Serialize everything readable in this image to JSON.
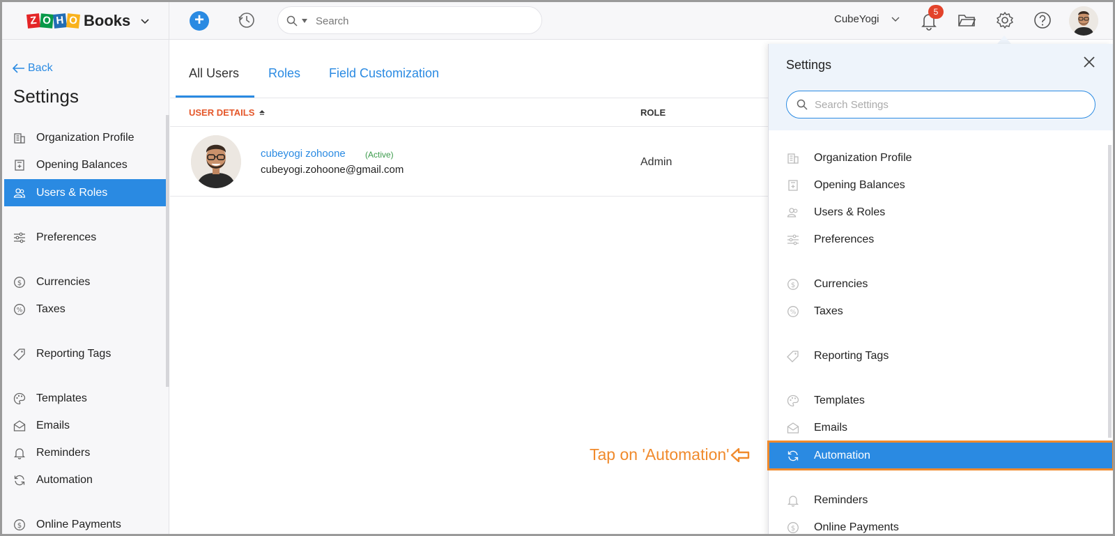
{
  "brand": {
    "letters": [
      "Z",
      "O",
      "H",
      "O"
    ],
    "product": "Books"
  },
  "topbar": {
    "search_placeholder": "Search",
    "org_name": "CubeYogi",
    "notification_count": "5"
  },
  "sidebar": {
    "back_label": "Back",
    "title": "Settings",
    "items": [
      {
        "label": "Organization Profile",
        "icon": "building-icon"
      },
      {
        "label": "Opening Balances",
        "icon": "ledger-icon"
      },
      {
        "label": "Users & Roles",
        "icon": "users-icon"
      },
      {
        "label": "Preferences",
        "icon": "sliders-icon"
      },
      {
        "label": "Currencies",
        "icon": "currency-icon"
      },
      {
        "label": "Taxes",
        "icon": "percent-icon"
      },
      {
        "label": "Reporting Tags",
        "icon": "tag-icon"
      },
      {
        "label": "Templates",
        "icon": "palette-icon"
      },
      {
        "label": "Emails",
        "icon": "envelope-icon"
      },
      {
        "label": "Reminders",
        "icon": "bell-icon"
      },
      {
        "label": "Automation",
        "icon": "refresh-icon"
      },
      {
        "label": "Online Payments",
        "icon": "payment-icon"
      }
    ],
    "active": "Users & Roles"
  },
  "main": {
    "tabs": [
      {
        "label": "All Users"
      },
      {
        "label": "Roles"
      },
      {
        "label": "Field Customization"
      }
    ],
    "table": {
      "col_user": "USER DETAILS",
      "col_role": "ROLE",
      "rows": [
        {
          "name": "cubeyogi zohoone",
          "status": "(Active)",
          "email": "cubeyogi.zohoone@gmail.com",
          "role": "Admin"
        }
      ]
    }
  },
  "panel": {
    "title": "Settings",
    "search_placeholder": "Search Settings",
    "items": [
      {
        "label": "Organization Profile"
      },
      {
        "label": "Opening Balances"
      },
      {
        "label": "Users & Roles"
      },
      {
        "label": "Preferences"
      },
      {
        "label": "Currencies"
      },
      {
        "label": "Taxes"
      },
      {
        "label": "Reporting Tags"
      },
      {
        "label": "Templates"
      },
      {
        "label": "Emails"
      },
      {
        "label": "Automation"
      },
      {
        "label": "Reminders"
      },
      {
        "label": "Online Payments"
      }
    ],
    "highlighted": "Automation"
  },
  "annotation": {
    "text": "Tap on 'Automation'"
  },
  "colors": {
    "accent": "#2a8ae2",
    "callout": "#f08a2c",
    "sort_header": "#e4572a",
    "badge": "#e3432b",
    "active_status": "#3a9a4a"
  }
}
